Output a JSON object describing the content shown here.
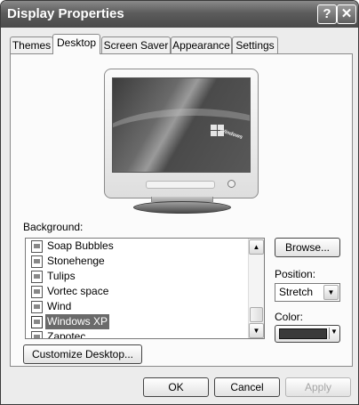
{
  "window": {
    "title": "Display Properties",
    "help_glyph": "?",
    "close_glyph": "✕"
  },
  "tabs": [
    {
      "label": "Themes"
    },
    {
      "label": "Desktop"
    },
    {
      "label": "Screen Saver"
    },
    {
      "label": "Appearance"
    },
    {
      "label": "Settings"
    }
  ],
  "active_tab": "Desktop",
  "preview": {
    "logo_text": "Windows"
  },
  "background": {
    "label": "Background:",
    "items": [
      {
        "label": "Soap Bubbles"
      },
      {
        "label": "Stonehenge"
      },
      {
        "label": "Tulips"
      },
      {
        "label": "Vortec space"
      },
      {
        "label": "Wind"
      },
      {
        "label": "Windows XP"
      },
      {
        "label": "Zapotec"
      }
    ],
    "selected": "Windows XP",
    "scroll_up_glyph": "▲",
    "scroll_down_glyph": "▼"
  },
  "browse_label": "Browse...",
  "position": {
    "label": "Position:",
    "value": "Stretch",
    "arrow_glyph": "▼"
  },
  "color": {
    "label": "Color:",
    "value": "#3a3a3a",
    "arrow_glyph": "▼"
  },
  "customize_label": "Customize Desktop...",
  "footer": {
    "ok_label": "OK",
    "cancel_label": "Cancel",
    "apply_label": "Apply"
  },
  "icons": [
    "help-icon",
    "close-icon",
    "picture-file-icon",
    "scroll-up-icon",
    "scroll-down-icon",
    "dropdown-arrow-icon"
  ]
}
